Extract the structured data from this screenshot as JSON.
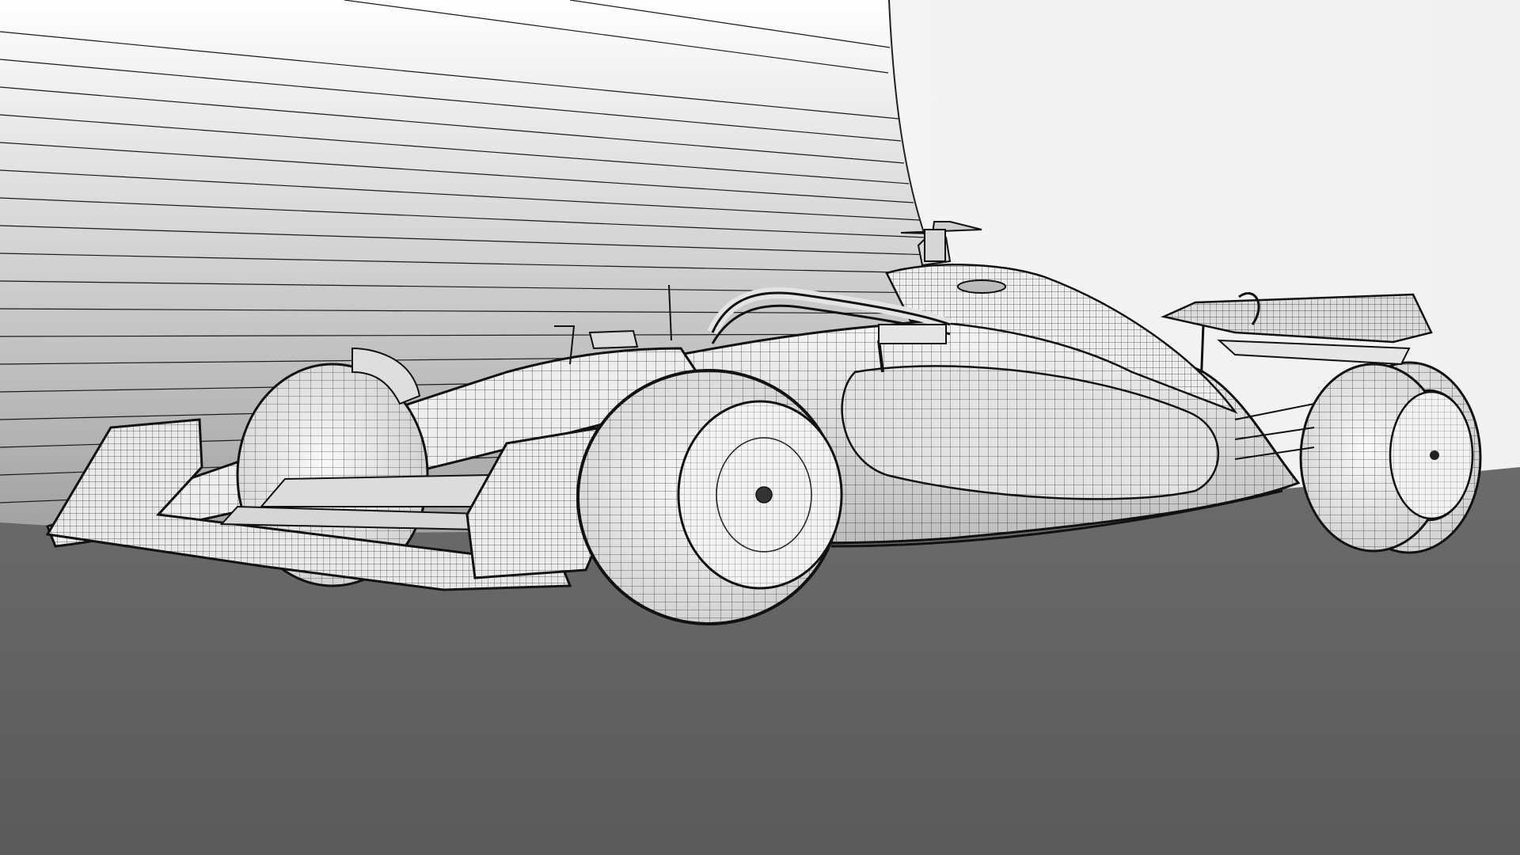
{
  "viewport": {
    "background_right": "#f4f4f4",
    "background_left_top": "#ffffff",
    "background_left_bottom": "#a8a8a8",
    "floor_near": "#5a5a5a",
    "floor_far": "#6a6a6a",
    "wire_color": "#1a1a1a",
    "surface_color": "#ececec"
  }
}
